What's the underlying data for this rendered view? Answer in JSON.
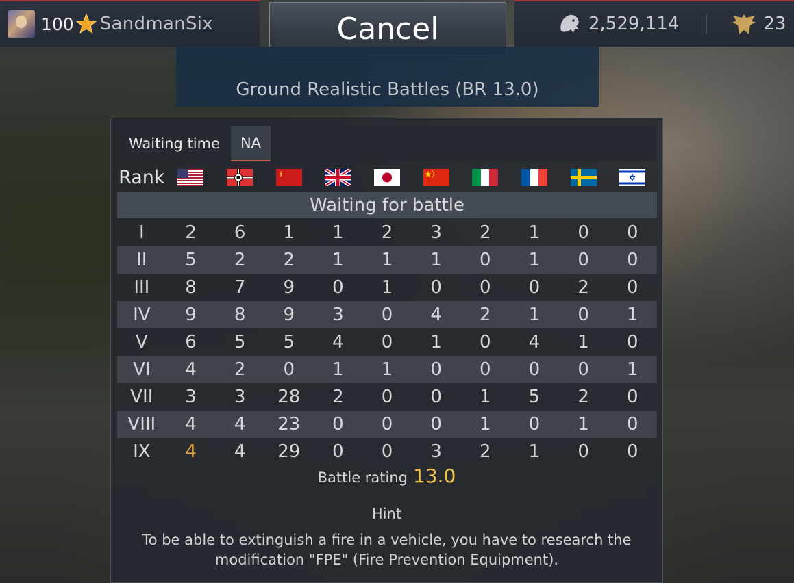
{
  "player": {
    "level": "100",
    "username": "SandmanSix"
  },
  "top_button": {
    "label": "Cancel"
  },
  "currency": {
    "lions": "2,529,114",
    "eagles": "23"
  },
  "mode": {
    "title": "Ground Realistic Battles (BR 13.0)"
  },
  "tabs": [
    {
      "label": "Waiting time"
    },
    {
      "label": "NA"
    }
  ],
  "table": {
    "rank_header": "Rank",
    "nations": [
      "usa-flag",
      "germany-flag",
      "ussr-flag",
      "britain-flag",
      "japan-flag",
      "china-flag",
      "italy-flag",
      "france-flag",
      "sweden-flag",
      "israel-flag"
    ],
    "status": "Waiting for battle",
    "rows": [
      {
        "rank": "I",
        "values": [
          "2",
          "6",
          "1",
          "1",
          "2",
          "3",
          "2",
          "1",
          "0",
          "0"
        ]
      },
      {
        "rank": "II",
        "values": [
          "5",
          "2",
          "2",
          "1",
          "1",
          "1",
          "0",
          "1",
          "0",
          "0"
        ]
      },
      {
        "rank": "III",
        "values": [
          "8",
          "7",
          "9",
          "0",
          "1",
          "0",
          "0",
          "0",
          "2",
          "0"
        ]
      },
      {
        "rank": "IV",
        "values": [
          "9",
          "8",
          "9",
          "3",
          "0",
          "4",
          "2",
          "1",
          "0",
          "1"
        ]
      },
      {
        "rank": "V",
        "values": [
          "6",
          "5",
          "5",
          "4",
          "0",
          "1",
          "0",
          "4",
          "1",
          "0"
        ]
      },
      {
        "rank": "VI",
        "values": [
          "4",
          "2",
          "0",
          "1",
          "1",
          "0",
          "0",
          "0",
          "0",
          "1"
        ]
      },
      {
        "rank": "VII",
        "values": [
          "3",
          "3",
          "28",
          "2",
          "0",
          "0",
          "1",
          "5",
          "2",
          "0"
        ]
      },
      {
        "rank": "VIII",
        "values": [
          "4",
          "4",
          "23",
          "0",
          "0",
          "0",
          "1",
          "0",
          "1",
          "0"
        ]
      },
      {
        "rank": "IX",
        "values": [
          "4",
          "4",
          "29",
          "0",
          "0",
          "3",
          "2",
          "1",
          "0",
          "0"
        ]
      }
    ],
    "highlight_color": "#e6a23a"
  },
  "battle_rating": {
    "label": "Battle rating",
    "value": "13.0"
  },
  "hint": {
    "title": "Hint",
    "text": "To be able to extinguish a fire in a vehicle, you have to research the modification \"FPE\" (Fire Prevention Equipment)."
  },
  "colors": {
    "accent_red": "#c8504a",
    "br_gold": "#f1c54a",
    "panel": "#262a30"
  }
}
